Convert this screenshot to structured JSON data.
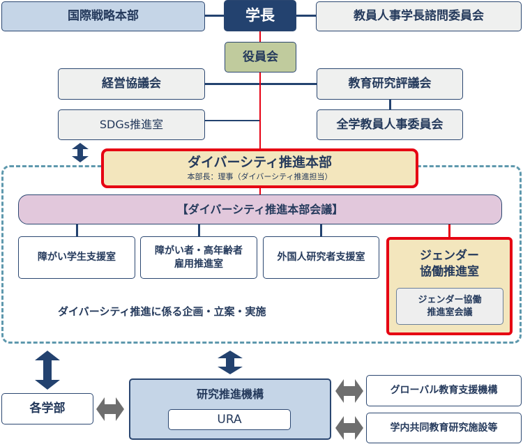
{
  "top": {
    "intl": "国際戦略本部",
    "president": "学長",
    "advisory": "教員人事学長諮問委員会"
  },
  "board": "役員会",
  "management": "経営協議会",
  "edu_council": "教育研究評議会",
  "sdgs": "SDGs推進室",
  "faculty_committee": "全学教員人事委員会",
  "hq": {
    "title": "ダイバーシティ推進本部",
    "subtitle": "本部長：理事（ダイバーシティ推進担当）"
  },
  "meeting": "【ダイバーシティ推進本部会議】",
  "offices": [
    "障がい学生支援室",
    "障がい者・高年齢者\n雇用推進室",
    "外国人研究者支援室"
  ],
  "gender": {
    "title": "ジェンダー\n協働推進室",
    "meeting": "ジェンダー協働\n推進室会議"
  },
  "mission": "ダイバーシティ推進に係る企画・立案・実施",
  "bottom": {
    "faculties": "各学部",
    "research": "研究推進機構",
    "ura": "URA",
    "global": "グローバル教育支援機構",
    "shared": "学内共同教育研究施設等"
  },
  "colors": {
    "navy": "#23426f",
    "red": "#e60012",
    "light_blue": "#c5d5e7",
    "olive": "#c0cb9d",
    "cream": "#f3e6bd",
    "pink": "#e2c8dc",
    "dashed": "#5e98ad",
    "gray_arrow": "#6e6e6e"
  }
}
